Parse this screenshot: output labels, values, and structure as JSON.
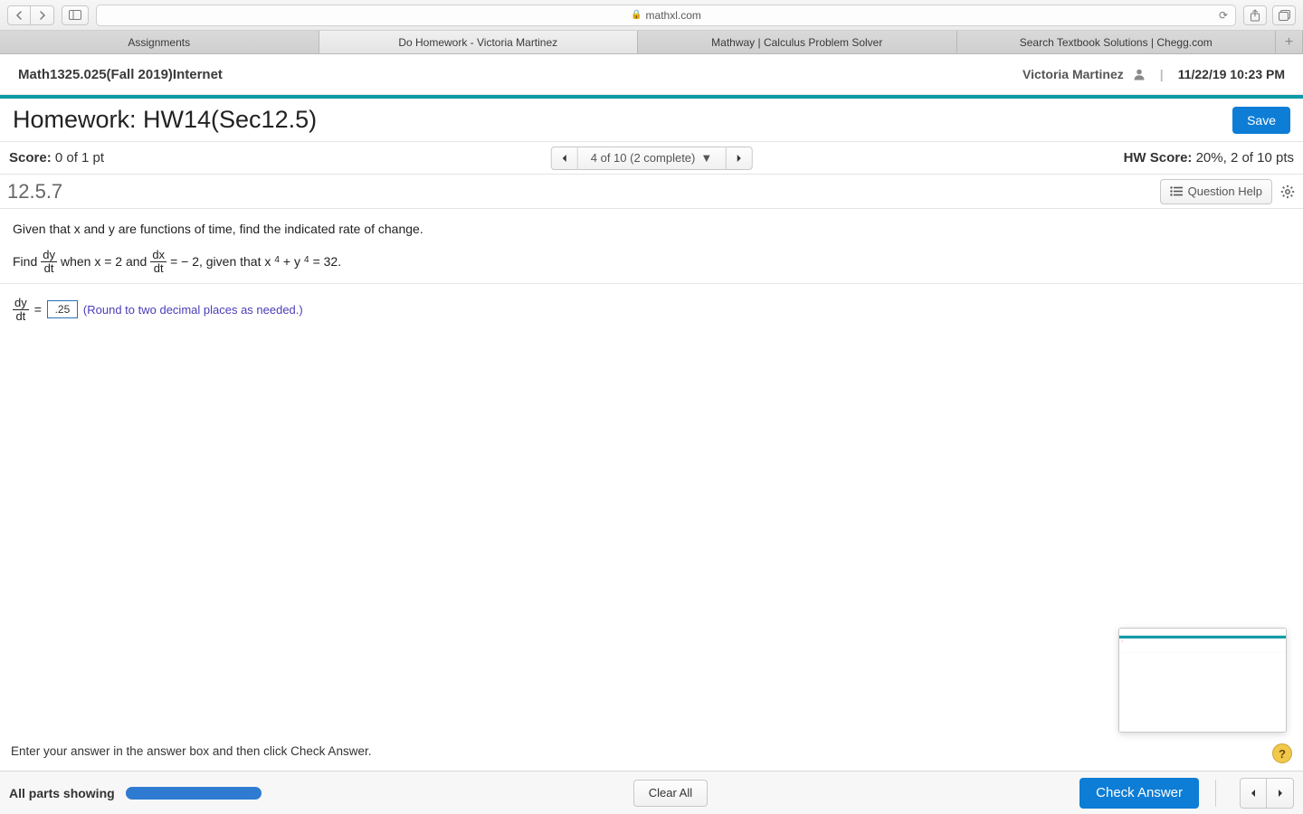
{
  "browser": {
    "url_host": "mathxl.com",
    "tabs": [
      {
        "label": "Assignments",
        "active": false
      },
      {
        "label": "Do Homework - Victoria Martinez",
        "active": true
      },
      {
        "label": "Mathway | Calculus Problem Solver",
        "active": false
      },
      {
        "label": "Search Textbook Solutions | Chegg.com",
        "active": false
      }
    ]
  },
  "header": {
    "course": "Math1325.025(Fall 2019)Internet",
    "user": "Victoria Martinez",
    "datetime": "11/22/19 10:23 PM"
  },
  "homework": {
    "title": "Homework: HW14(Sec12.5)",
    "save_label": "Save"
  },
  "score_bar": {
    "score_label": "Score:",
    "score_value": "0 of 1 pt",
    "nav_label": "4 of 10 (2 complete)",
    "hw_score_label": "HW Score:",
    "hw_score_value": "20%, 2 of 10 pts"
  },
  "question": {
    "number": "12.5.7",
    "help_label": "Question Help",
    "intro": "Given that x and y are functions of time, find the indicated rate of change.",
    "line_parts": {
      "find": "Find",
      "when": "when x = 2 and",
      "eq": "= − 2, given that x",
      "plus": "+ y",
      "tail": "= 32."
    },
    "answer_value": ".25",
    "hint": "(Round to two decimal places as needed.)"
  },
  "footer": {
    "instruction": "Enter your answer in the answer box and then click Check Answer.",
    "parts_label": "All parts showing",
    "clear_label": "Clear All",
    "check_label": "Check Answer"
  }
}
